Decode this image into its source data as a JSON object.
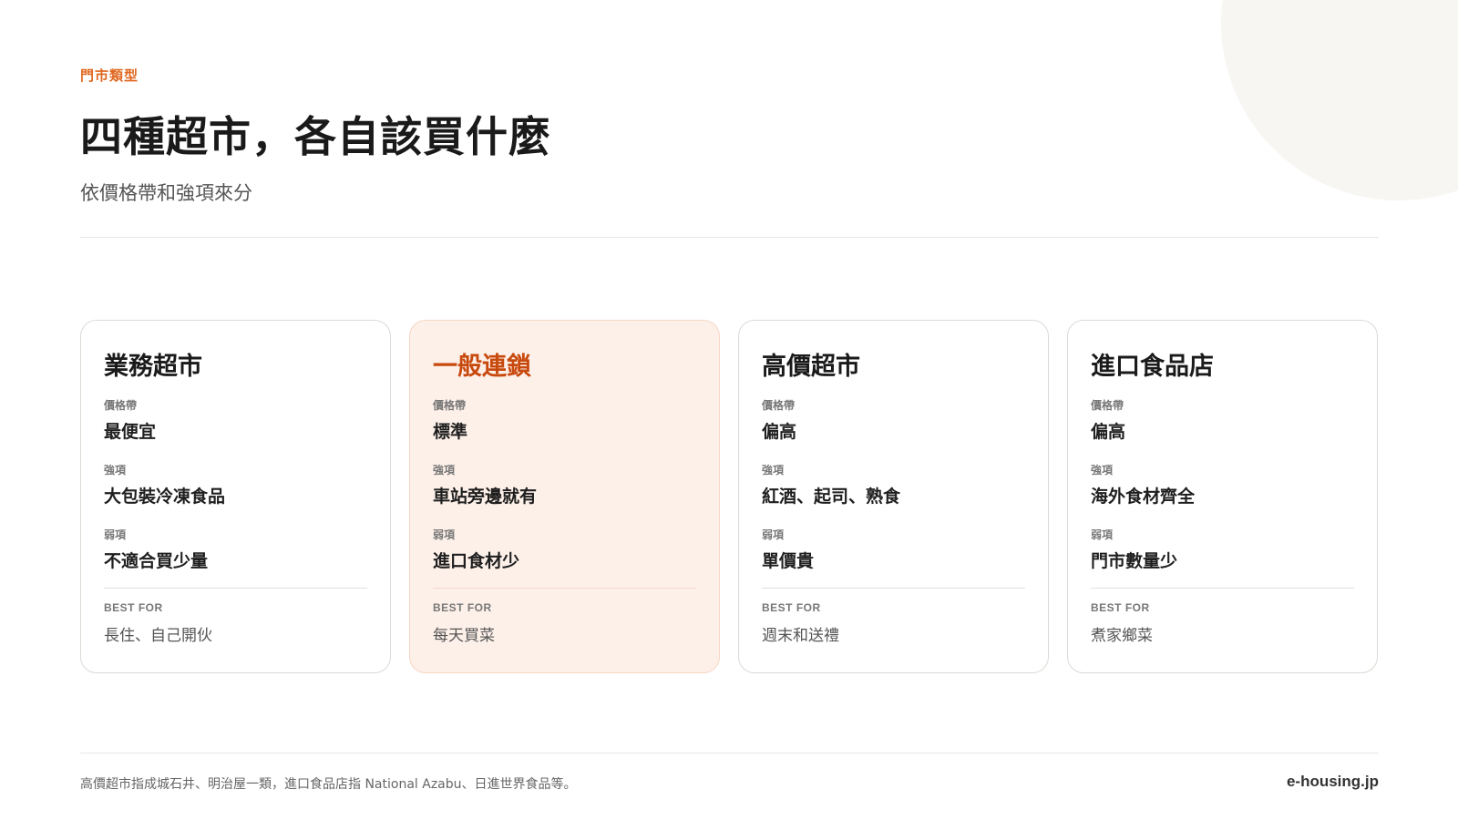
{
  "header": {
    "eyebrow": "門市類型",
    "title": "四種超市，各自該買什麼",
    "subtitle": "依價格帶和強項來分"
  },
  "cards": [
    {
      "title": "業務超市",
      "price_label": "價格帶",
      "price_value": "最便宜",
      "strength_label": "強項",
      "strength_value": "大包裝冷凍食品",
      "weakness_label": "弱項",
      "weakness_value": "不適合買少量",
      "best_for_label": "BEST FOR",
      "best_for_value": "長住、自己開伙"
    },
    {
      "title": "一般連鎖",
      "price_label": "價格帶",
      "price_value": "標準",
      "strength_label": "強項",
      "strength_value": "車站旁邊就有",
      "weakness_label": "弱項",
      "weakness_value": "進口食材少",
      "best_for_label": "BEST FOR",
      "best_for_value": "每天買菜"
    },
    {
      "title": "高價超市",
      "price_label": "價格帶",
      "price_value": "偏高",
      "strength_label": "強項",
      "strength_value": "紅酒、起司、熟食",
      "weakness_label": "弱項",
      "weakness_value": "單價貴",
      "best_for_label": "BEST FOR",
      "best_for_value": "週末和送禮"
    },
    {
      "title": "進口食品店",
      "price_label": "價格帶",
      "price_value": "偏高",
      "strength_label": "強項",
      "strength_value": "海外食材齊全",
      "weakness_label": "弱項",
      "weakness_value": "門市數量少",
      "best_for_label": "BEST FOR",
      "best_for_value": "煮家鄉菜"
    }
  ],
  "footer": {
    "note": "高價超市指成城石井、明治屋一類，進口食品店指 National Azabu、日進世界食品等。",
    "brand": "e-housing.jp"
  },
  "colors": {
    "accent": "#e0671f",
    "highlight_title": "#c8490d",
    "highlight_bg": "#fdf0e9"
  }
}
